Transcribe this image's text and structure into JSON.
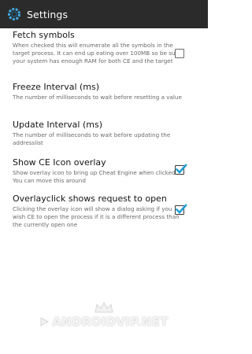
{
  "actionbar": {
    "title": "Settings",
    "icon": "cheat-engine-gear-icon"
  },
  "preferences": [
    {
      "title": "Fetch symbols",
      "summary": "When checked this will enumerate all the symbols in the target process. It can end up eating over 100MB so be sure your system has enough RAM for both CE and the target",
      "checkbox": false
    },
    {
      "title": "Freeze Interval (ms)",
      "summary": "The number of milliseconds to wait before resetting a value"
    },
    {
      "title": "Update Interval (ms)",
      "summary": "The number of milliseconds to wait before updating the addresslist"
    },
    {
      "title": "Show CE Icon overlay",
      "summary": "Show overlay icon to bring up Cheat Engine when clicked. You can move this around",
      "checkbox": true
    },
    {
      "title": "Overlayclick shows request to open",
      "summary": "Clicking the overlay icon will show a dialog asking if you wish CE to open the process if it is a different process than the currently open one",
      "checkbox": true
    }
  ],
  "watermark": {
    "text": "ANDROIDVIP.NET"
  },
  "colors": {
    "actionbar": "#2b2b2b",
    "check": "#1f9fd4"
  }
}
